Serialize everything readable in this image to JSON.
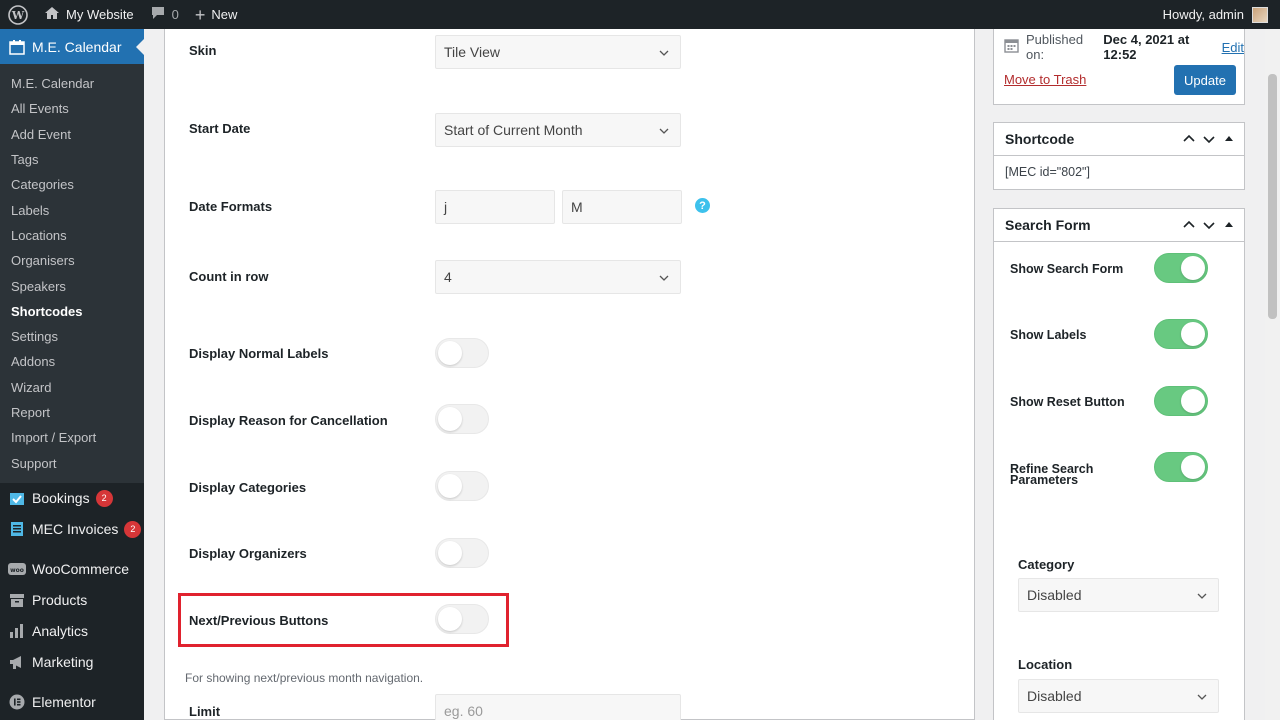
{
  "adminbar": {
    "site_name": "My Website",
    "comments_count": "0",
    "new_label": "New",
    "howdy": "Howdy, admin"
  },
  "sidebar": {
    "top_label": "M.E. Calendar",
    "sub_items": [
      {
        "label": "M.E. Calendar"
      },
      {
        "label": "All Events"
      },
      {
        "label": "Add Event"
      },
      {
        "label": "Tags"
      },
      {
        "label": "Categories"
      },
      {
        "label": "Labels"
      },
      {
        "label": "Locations"
      },
      {
        "label": "Organisers"
      },
      {
        "label": "Speakers"
      },
      {
        "label": "Shortcodes"
      },
      {
        "label": "Settings"
      },
      {
        "label": "Addons"
      },
      {
        "label": "Wizard"
      },
      {
        "label": "Report"
      },
      {
        "label": "Import / Export"
      },
      {
        "label": "Support"
      }
    ],
    "items": [
      {
        "label": "Bookings",
        "badge": "2"
      },
      {
        "label": "MEC Invoices",
        "badge": "2"
      },
      {
        "label": "WooCommerce"
      },
      {
        "label": "Products"
      },
      {
        "label": "Analytics"
      },
      {
        "label": "Marketing"
      },
      {
        "label": "Elementor"
      }
    ]
  },
  "form": {
    "skin_label": "Skin",
    "skin_value": "Tile View",
    "start_date_label": "Start Date",
    "start_date_value": "Start of Current Month",
    "date_formats_label": "Date Formats",
    "date_format_1": "j",
    "date_format_2": "M",
    "help_icon": "?",
    "count_label": "Count in row",
    "count_value": "4",
    "normal_labels_label": "Display Normal Labels",
    "normal_labels_on": false,
    "cancellation_label": "Display Reason for Cancellation",
    "cancellation_on": false,
    "categories_label": "Display Categories",
    "categories_on": false,
    "organizers_label": "Display Organizers",
    "organizers_on": false,
    "next_prev_label": "Next/Previous Buttons",
    "next_prev_on": false,
    "next_prev_desc": "For showing next/previous month navigation.",
    "limit_label": "Limit",
    "limit_placeholder": "eg. 60"
  },
  "publish": {
    "published_on_label": "Published on:",
    "published_date": "Dec 4, 2021 at 12:52",
    "edit_link": "Edit",
    "trash_link": "Move to Trash",
    "update_button": "Update"
  },
  "shortcode_box": {
    "title": "Shortcode",
    "code": "[MEC id=\"802\"]"
  },
  "search_form_box": {
    "title": "Search Form",
    "show_search_form": "Show Search Form",
    "show_labels": "Show Labels",
    "show_reset": "Show Reset Button",
    "refine_search": "Refine Search Parameters",
    "toggles_on": [
      true,
      true,
      true,
      true
    ],
    "category_label": "Category",
    "category_value": "Disabled",
    "location_label": "Location",
    "location_value": "Disabled"
  },
  "colors": {
    "admin_dark": "#1d2327",
    "accent_blue": "#2271b1",
    "toggle_on": "#68c981",
    "highlight_red": "#e0222e",
    "badge_red": "#d63638"
  }
}
